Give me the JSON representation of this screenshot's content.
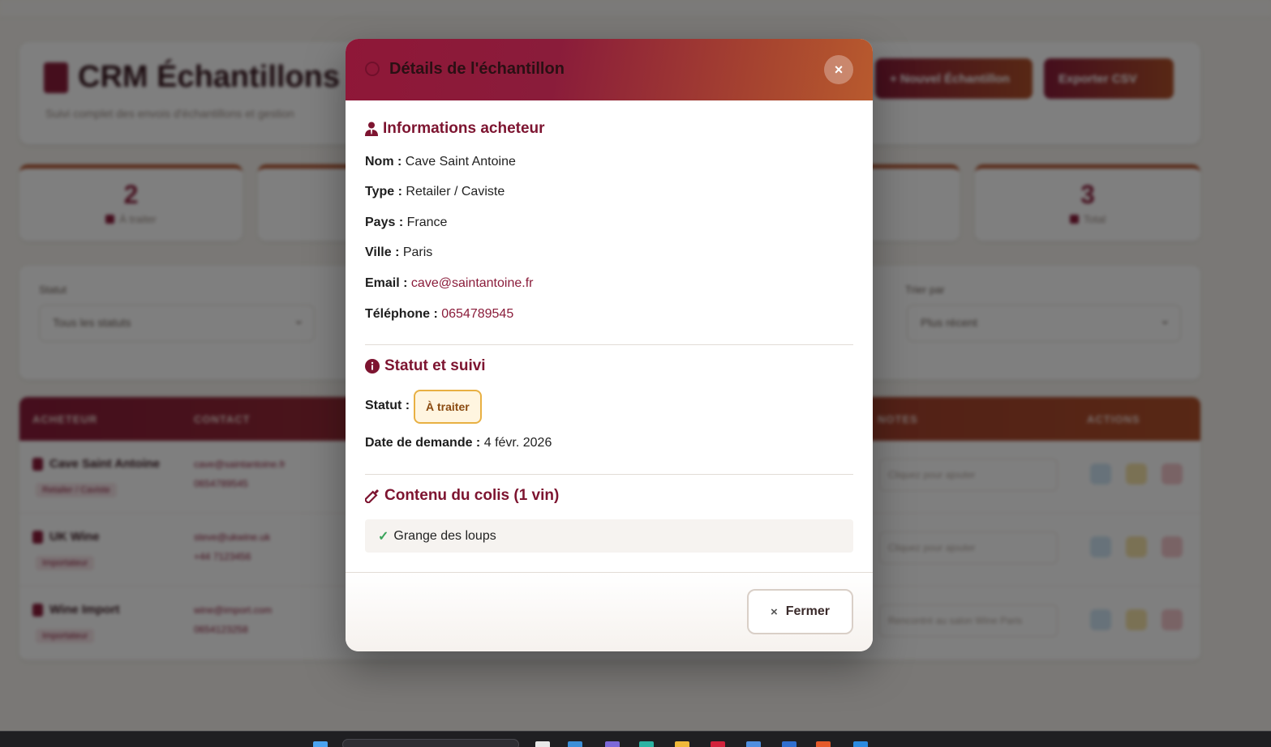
{
  "background": {
    "app_title": "CRM Échantillons",
    "subtitle": "Suivi complet des envois d'échantillons et gestion",
    "new_button": "+ Nouvel Échantillon",
    "export_button": "Exporter CSV",
    "stats": [
      {
        "value": "2",
        "label": "À traiter"
      },
      {
        "value": "3",
        "label": "Total"
      }
    ],
    "filters": [
      {
        "label": "Statut",
        "value": "Tous les statuts"
      },
      {
        "label": "Trier par",
        "value": "Plus récent"
      }
    ],
    "table_headers": [
      "ACHETEUR",
      "CONTACT",
      "NOTES",
      "ACTIONS"
    ],
    "rows": [
      {
        "name": "Cave Saint Antoine",
        "tag": "Retailer / Caviste",
        "email": "cave@saintantoine.fr",
        "phone": "0654789545",
        "note": "Cliquez pour ajouter"
      },
      {
        "name": "UK Wine",
        "tag": "Importateur",
        "email": "steve@ukwine.uk",
        "phone": "+44 7123456",
        "note": "Cliquez pour ajouter"
      },
      {
        "name": "Wine Import",
        "tag": "Importateur",
        "email": "wine@import.com",
        "phone": "0654123258",
        "note": "Rencontré au salon Wine Paris"
      }
    ]
  },
  "modal": {
    "title": "Détails de l'échantillon",
    "close_icon": "×",
    "buyer_section": {
      "title": "Informations acheteur",
      "icon": "user-tie-icon",
      "fields": [
        {
          "label": "Nom :",
          "value": "Cave Saint Antoine"
        },
        {
          "label": "Type :",
          "value": "Retailer / Caviste"
        },
        {
          "label": "Pays :",
          "value": "France"
        },
        {
          "label": "Ville :",
          "value": "Paris"
        }
      ],
      "email_label": "Email :",
      "email": "cave@saintantoine.fr",
      "phone_label": "Téléphone :",
      "phone": "0654789545"
    },
    "status_section": {
      "title": "Statut et suivi",
      "icon": "info-circle-icon",
      "status_label": "Statut :",
      "status_value": "À traiter",
      "date_label": "Date de demande :",
      "date_value": "4 févr. 2026"
    },
    "contents_section": {
      "title": "Contenu du colis (1 vin)",
      "icon": "wine-bottle-icon",
      "wines": [
        "Grange des loups"
      ]
    },
    "footer": {
      "close_button": "Fermer",
      "close_button_icon": "×"
    }
  },
  "colors": {
    "primary": "#8a1c3a",
    "accent": "#b85a2e",
    "status_border": "#e8b043",
    "check": "#3aa35a"
  }
}
